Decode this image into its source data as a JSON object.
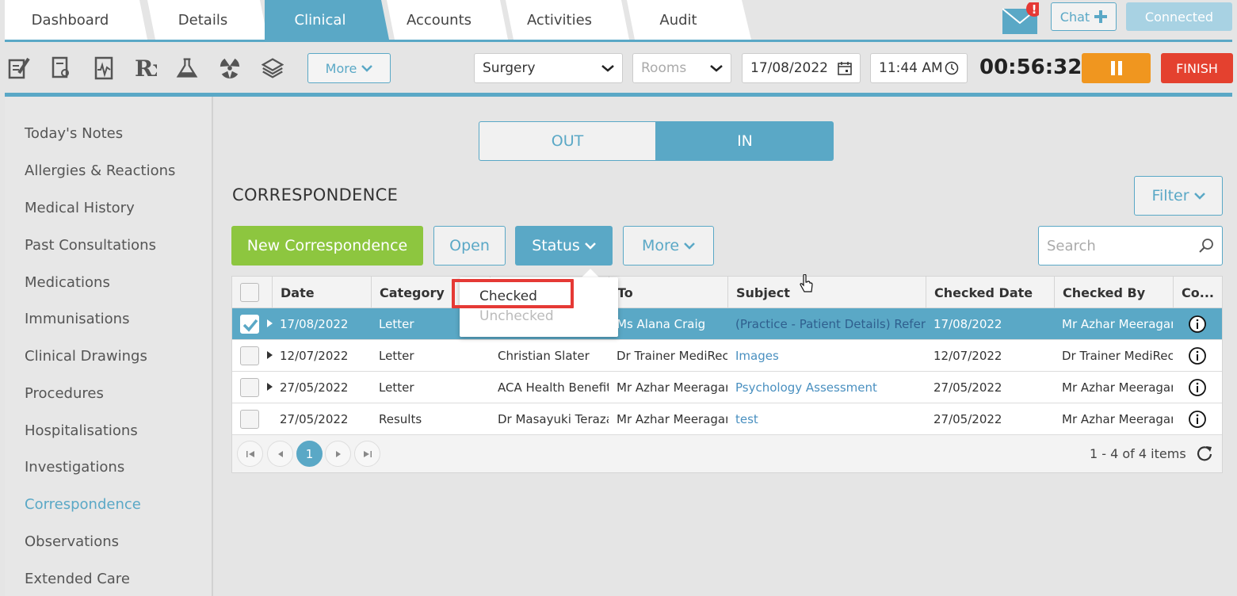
{
  "tabs": [
    {
      "label": "Dashboard"
    },
    {
      "label": "Details"
    },
    {
      "label": "Clinical"
    },
    {
      "label": "Accounts"
    },
    {
      "label": "Activities"
    },
    {
      "label": "Audit"
    }
  ],
  "header": {
    "chat_label": "Chat",
    "connected_label": "Connected",
    "notification_badge": "!"
  },
  "toolbar": {
    "more_label": "More",
    "location_value": "Surgery",
    "rooms_placeholder": "Rooms",
    "date_value": "17/08/2022",
    "time_value": "11:44 AM",
    "timer_value": "00:56:32",
    "finish_label": "FINISH"
  },
  "sidebar": {
    "items": [
      {
        "label": "Today's Notes"
      },
      {
        "label": "Allergies & Reactions"
      },
      {
        "label": "Medical History"
      },
      {
        "label": "Past Consultations"
      },
      {
        "label": "Medications"
      },
      {
        "label": "Immunisations"
      },
      {
        "label": "Clinical Drawings"
      },
      {
        "label": "Procedures"
      },
      {
        "label": "Hospitalisations"
      },
      {
        "label": "Investigations"
      },
      {
        "label": "Correspondence"
      },
      {
        "label": "Observations"
      },
      {
        "label": "Extended Care"
      }
    ]
  },
  "main": {
    "toggle_out": "OUT",
    "toggle_in": "IN",
    "title": "CORRESPONDENCE",
    "filter_label": "Filter",
    "new_label": "New Correspondence",
    "open_label": "Open",
    "status_label": "Status",
    "more_label": "More",
    "search_placeholder": "Search"
  },
  "status_menu": {
    "checked": "Checked",
    "unchecked": "Unchecked"
  },
  "grid": {
    "columns": [
      "Date",
      "Category",
      "",
      "To",
      "Subject",
      "Checked Date",
      "Checked By",
      "Co..."
    ],
    "rows": [
      {
        "date": "17/08/2022",
        "category": "Letter",
        "from": "",
        "to": "Ms Alana Craig",
        "subject": "(Practice - Patient Details) Referral",
        "checked_date": "17/08/2022",
        "checked_by": "Mr Azhar Meeragani"
      },
      {
        "date": "12/07/2022",
        "category": "Letter",
        "from": "Christian Slater",
        "to": "Dr Trainer MediRecords",
        "subject": "Images",
        "checked_date": "12/07/2022",
        "checked_by": "Dr Trainer MediRecords"
      },
      {
        "date": "27/05/2022",
        "category": "Letter",
        "from": "ACA Health Benefits",
        "to": "Mr Azhar Meeragani",
        "subject": "Psychology Assessment",
        "checked_date": "27/05/2022",
        "checked_by": "Mr Azhar Meeragani"
      },
      {
        "date": "27/05/2022",
        "category": "Results",
        "from": "Dr Masayuki Terazawa",
        "to": "Mr Azhar Meeragani",
        "subject": "test",
        "checked_date": "27/05/2022",
        "checked_by": "Mr Azhar Meeragani"
      }
    ],
    "page": "1",
    "pager_info": "1 - 4 of 4 items"
  }
}
